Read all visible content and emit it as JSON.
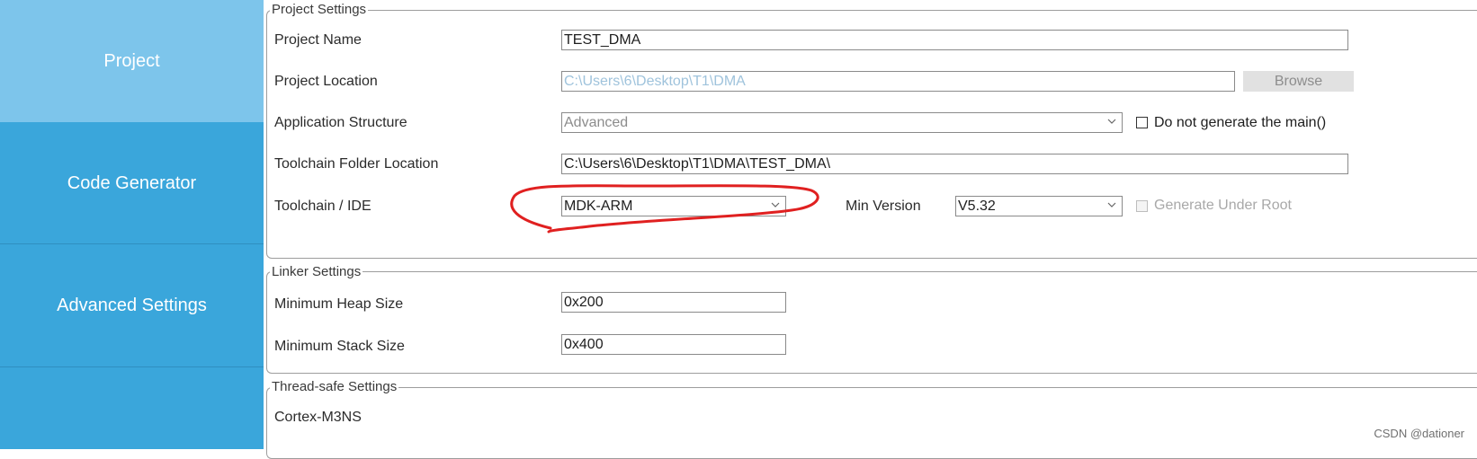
{
  "sidebar": {
    "items": [
      {
        "label": "Project",
        "active": true
      },
      {
        "label": "Code Generator",
        "active": false
      },
      {
        "label": "Advanced Settings",
        "active": false
      }
    ]
  },
  "project_settings": {
    "legend": "Project Settings",
    "project_name": {
      "label": "Project Name",
      "value": "TEST_DMA"
    },
    "project_location": {
      "label": "Project Location",
      "value": "C:\\Users\\6\\Desktop\\T1\\DMA",
      "browse_label": "Browse"
    },
    "application_structure": {
      "label": "Application Structure",
      "value": "Advanced",
      "checkbox_label": "Do not generate the main()"
    },
    "toolchain_folder": {
      "label": "Toolchain Folder Location",
      "value": "C:\\Users\\6\\Desktop\\T1\\DMA\\TEST_DMA\\"
    },
    "toolchain_ide": {
      "label": "Toolchain / IDE",
      "value": "MDK-ARM",
      "min_version_label": "Min Version",
      "min_version_value": "V5.32",
      "checkbox_label": "Generate Under Root"
    }
  },
  "linker_settings": {
    "legend": "Linker Settings",
    "heap": {
      "label": "Minimum Heap Size",
      "value": "0x200"
    },
    "stack": {
      "label": "Minimum Stack Size",
      "value": "0x400"
    }
  },
  "thread_safe": {
    "legend": "Thread-safe Settings",
    "core": "Cortex-M3NS"
  },
  "watermark": "CSDN @dationer",
  "colors": {
    "sidebar": "#3aa6db",
    "sidebar_active": "#7dc5eb",
    "annotation": "#e02020"
  }
}
